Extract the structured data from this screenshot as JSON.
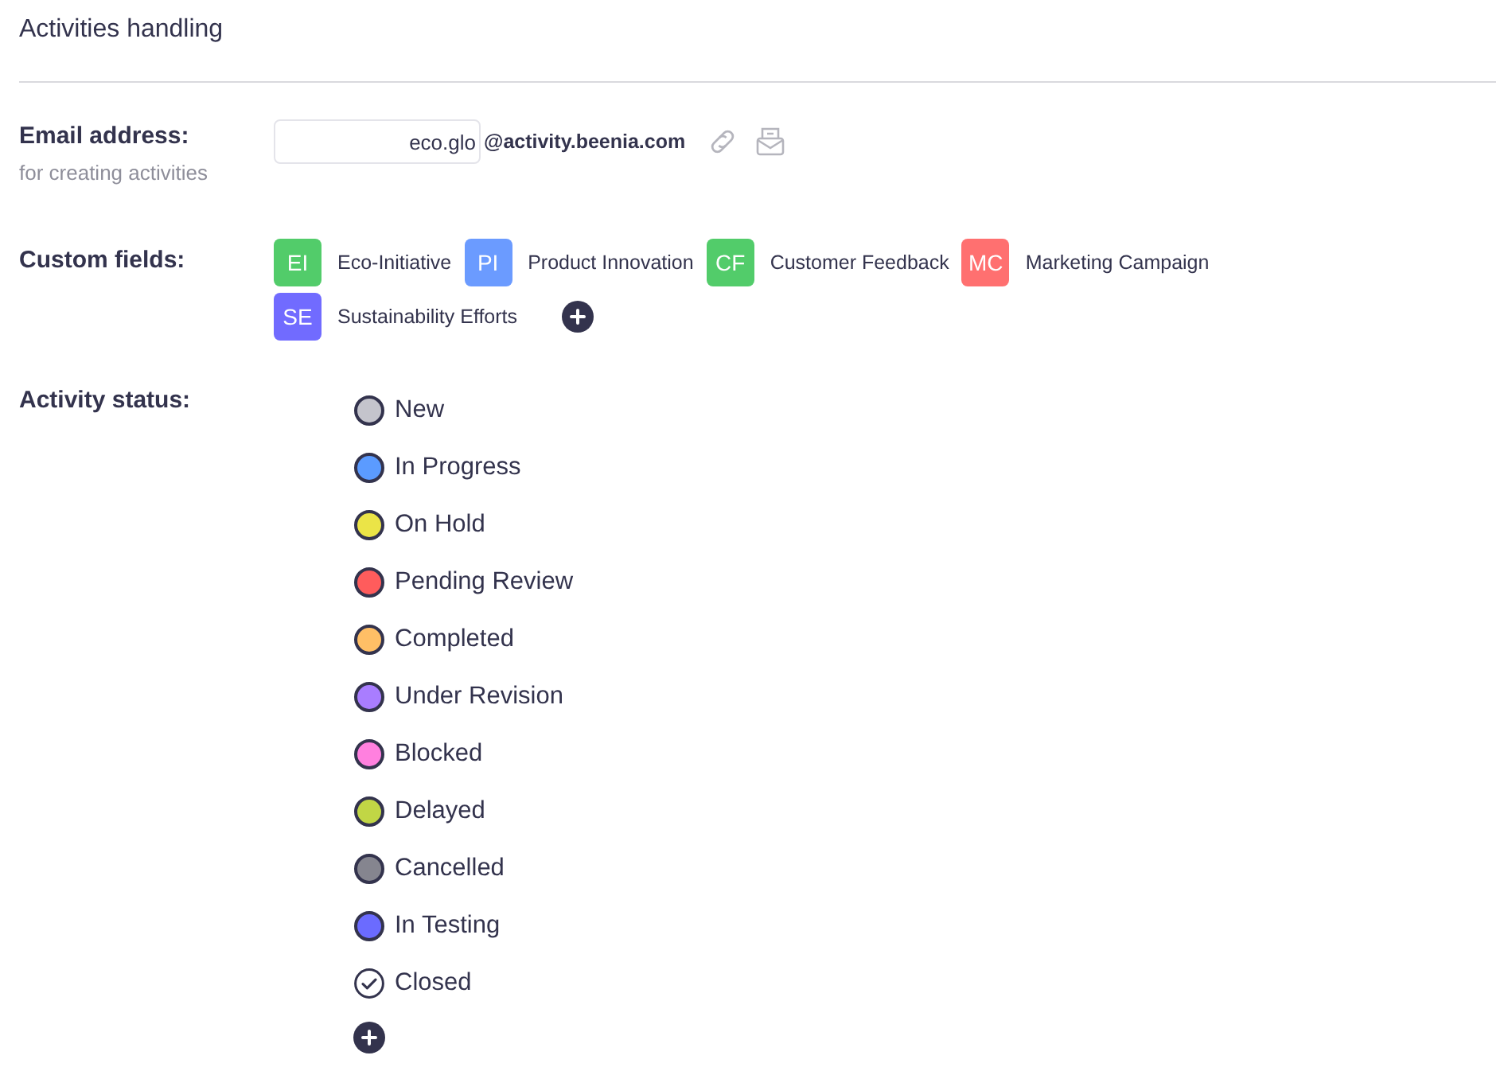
{
  "title": "Activities handling",
  "email": {
    "label": "Email address:",
    "hint": "for creating activities",
    "value": "eco.glo",
    "domain": "@activity.beenia.com"
  },
  "custom_fields": {
    "label": "Custom fields:",
    "items": [
      {
        "initials": "EI",
        "name": "Eco-Initiative",
        "color": "#52cc6a"
      },
      {
        "initials": "PI",
        "name": "Product Innovation",
        "color": "#6b9bff"
      },
      {
        "initials": "CF",
        "name": "Customer Feedback",
        "color": "#52cc6a"
      },
      {
        "initials": "MC",
        "name": "Marketing Campaign",
        "color": "#ff7070"
      },
      {
        "initials": "SE",
        "name": "Sustainability Efforts",
        "color": "#716bff"
      }
    ]
  },
  "activity_status": {
    "label": "Activity status:",
    "items": [
      {
        "kind": "dot",
        "name": "New",
        "color": "#c4c4cc"
      },
      {
        "kind": "dot",
        "name": "In Progress",
        "color": "#5b9bff"
      },
      {
        "kind": "dot",
        "name": "On Hold",
        "color": "#ebe447"
      },
      {
        "kind": "dot",
        "name": "Pending Review",
        "color": "#ff5c5c"
      },
      {
        "kind": "dot",
        "name": "Completed",
        "color": "#ffbf66"
      },
      {
        "kind": "dot",
        "name": "Under Revision",
        "color": "#a97dff"
      },
      {
        "kind": "dot",
        "name": "Blocked",
        "color": "#ff80df"
      },
      {
        "kind": "dot",
        "name": "Delayed",
        "color": "#c1d645"
      },
      {
        "kind": "dot",
        "name": "Cancelled",
        "color": "#85858f"
      },
      {
        "kind": "dot",
        "name": "In Testing",
        "color": "#6b6bff"
      },
      {
        "kind": "check",
        "name": "Closed"
      }
    ]
  }
}
